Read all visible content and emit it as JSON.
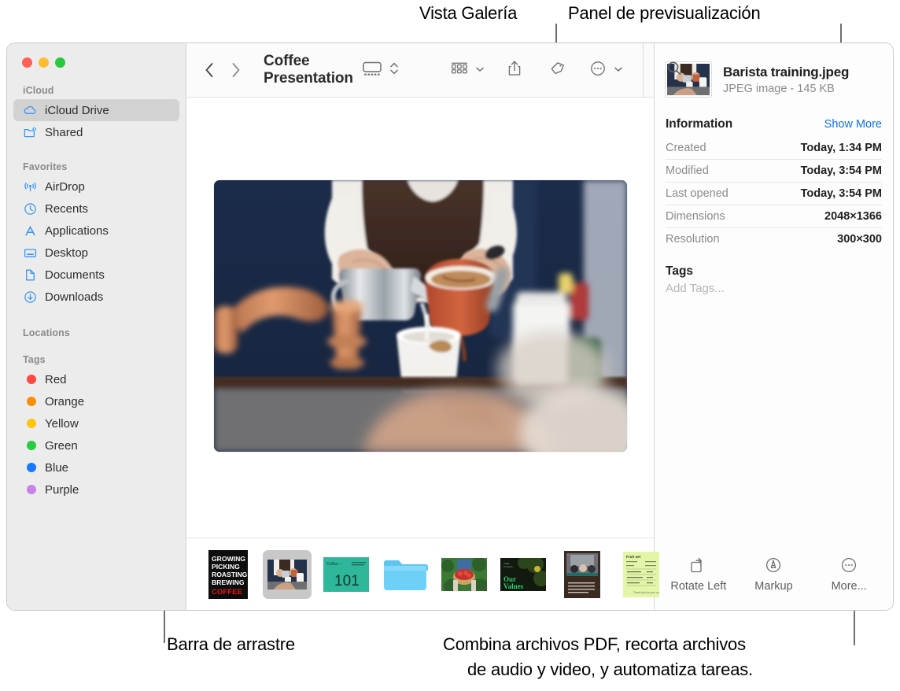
{
  "callouts": [
    {
      "id": "gallery-view",
      "text": "Vista Galería"
    },
    {
      "id": "preview-panel",
      "text": "Panel de previsualización"
    },
    {
      "id": "drag-bar",
      "text": "Barra de arrastre"
    },
    {
      "id": "quick-actions-line1",
      "text": "Combina archivos PDF, recorta archivos"
    },
    {
      "id": "quick-actions-line2",
      "text": "de audio y video, y automatiza tareas."
    }
  ],
  "window": {
    "traffic_lights": [
      {
        "name": "close",
        "color": "#ff5f57"
      },
      {
        "name": "minimize",
        "color": "#febc2e"
      },
      {
        "name": "zoom",
        "color": "#28c840"
      }
    ]
  },
  "sidebar": {
    "sections": [
      {
        "label": "iCloud",
        "items": [
          {
            "label": "iCloud Drive",
            "icon": "cloud-icon",
            "selected": true
          },
          {
            "label": "Shared",
            "icon": "shared-folder-icon",
            "selected": false
          }
        ]
      },
      {
        "label": "Favorites",
        "items": [
          {
            "label": "AirDrop",
            "icon": "airdrop-icon",
            "selected": false
          },
          {
            "label": "Recents",
            "icon": "clock-icon",
            "selected": false
          },
          {
            "label": "Applications",
            "icon": "applications-icon",
            "selected": false
          },
          {
            "label": "Desktop",
            "icon": "desktop-icon",
            "selected": false
          },
          {
            "label": "Documents",
            "icon": "document-icon",
            "selected": false
          },
          {
            "label": "Downloads",
            "icon": "download-icon",
            "selected": false
          }
        ]
      },
      {
        "label": "Locations",
        "items": []
      },
      {
        "label": "Tags",
        "items": [
          {
            "label": "Red",
            "icon": "tag-dot",
            "color": "#fc4a41"
          },
          {
            "label": "Orange",
            "icon": "tag-dot",
            "color": "#fa8e0a"
          },
          {
            "label": "Yellow",
            "icon": "tag-dot",
            "color": "#fdc60b"
          },
          {
            "label": "Green",
            "icon": "tag-dot",
            "color": "#27cc3f"
          },
          {
            "label": "Blue",
            "icon": "tag-dot",
            "color": "#157aff"
          },
          {
            "label": "Purple",
            "icon": "tag-dot",
            "color": "#c683e8"
          }
        ]
      }
    ]
  },
  "toolbar": {
    "back_icon": "chevron-left-icon",
    "forward_icon": "chevron-right-icon",
    "title": "Coffee Presentation",
    "view_gallery_icon": "gallery-view-icon",
    "view_stepper_icon": "up-down-chevrons-icon",
    "group_icon": "group-items-icon",
    "share_icon": "share-icon",
    "tag_icon": "tag-icon",
    "more_icon": "more-circle-icon",
    "search_icon": "search-icon"
  },
  "preview": {
    "hero_alt": "barista-pouring-coffee",
    "file": {
      "name": "Barista training.jpeg",
      "meta": "JPEG image - 145 KB"
    },
    "information": {
      "title": "Information",
      "show_more": "Show More",
      "rows": [
        {
          "label": "Created",
          "value": "Today, 1:34 PM"
        },
        {
          "label": "Modified",
          "value": "Today, 3:54 PM"
        },
        {
          "label": "Last opened",
          "value": "Today, 3:54 PM"
        },
        {
          "label": "Dimensions",
          "value": "2048×1366"
        },
        {
          "label": "Resolution",
          "value": "300×300"
        }
      ]
    },
    "tags": {
      "title": "Tags",
      "placeholder": "Add Tags..."
    },
    "actions": [
      {
        "label": "Rotate Left",
        "icon": "rotate-left-icon"
      },
      {
        "label": "Markup",
        "icon": "markup-icon"
      },
      {
        "label": "More...",
        "icon": "more-circle-icon"
      }
    ]
  },
  "filmstrip": {
    "items": [
      {
        "name": "coffee-process-poster",
        "type": "image",
        "selected": false,
        "lines": [
          "GROWING",
          "PICKING",
          "ROASTING",
          "BREWING",
          "COFFEE"
        ]
      },
      {
        "name": "barista-training-photo",
        "type": "image",
        "selected": true
      },
      {
        "name": "coffee-101-slide",
        "type": "image",
        "selected": false,
        "heading": "Coffee",
        "big_text": "101"
      },
      {
        "name": "folder",
        "type": "folder",
        "selected": false
      },
      {
        "name": "coffee-cherries-photo",
        "type": "image",
        "selected": false
      },
      {
        "name": "our-values-slide",
        "type": "image",
        "selected": false,
        "title_line1": "Our",
        "title_line2": "Values"
      },
      {
        "name": "meeting-document",
        "type": "document",
        "selected": false
      },
      {
        "name": "invoice-spreadsheet",
        "type": "document",
        "selected": false,
        "heading": "Fruit set"
      }
    ]
  },
  "colors": {
    "accent_blue": "#1273e6",
    "sidebar_bg": "#ececec",
    "selected_row": "#d2d2d2",
    "icon_blue": "#3b95f2"
  }
}
